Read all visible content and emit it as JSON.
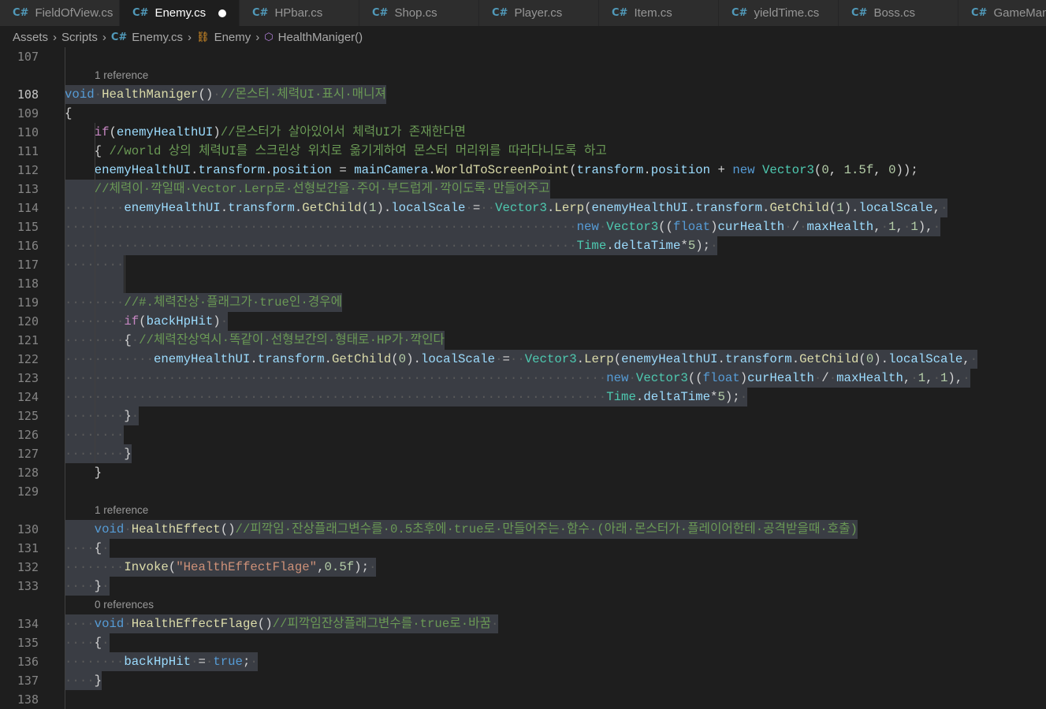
{
  "tabs": [
    {
      "label": "FieldOfView.cs",
      "icon": "csharp-file-icon",
      "active": false,
      "modified": false
    },
    {
      "label": "Enemy.cs",
      "icon": "csharp-file-icon",
      "active": true,
      "modified": true
    },
    {
      "label": "HPbar.cs",
      "icon": "csharp-file-icon",
      "active": false,
      "modified": false
    },
    {
      "label": "Shop.cs",
      "icon": "csharp-file-icon",
      "active": false,
      "modified": false
    },
    {
      "label": "Player.cs",
      "icon": "csharp-file-icon",
      "active": false,
      "modified": false
    },
    {
      "label": "Item.cs",
      "icon": "csharp-file-icon",
      "active": false,
      "modified": false
    },
    {
      "label": "yieldTime.cs",
      "icon": "csharp-file-icon",
      "active": false,
      "modified": false
    },
    {
      "label": "Boss.cs",
      "icon": "csharp-file-icon",
      "active": false,
      "modified": false
    },
    {
      "label": "GameManager.cs",
      "icon": "csharp-file-icon",
      "active": false,
      "modified": false
    }
  ],
  "breadcrumb": [
    {
      "label": "Assets",
      "icon": ""
    },
    {
      "label": "Scripts",
      "icon": ""
    },
    {
      "label": "Enemy.cs",
      "icon": "csharp-file-icon"
    },
    {
      "label": "Enemy",
      "icon": "class-icon"
    },
    {
      "label": "HealthManiger()",
      "icon": "method-icon"
    }
  ],
  "colors": {
    "editor_bg": "#1e1e1e",
    "tab_bar_bg": "#252526",
    "selection_bg": "#3a3d44",
    "keyword": "#569cd6",
    "control": "#c586c0",
    "function": "#dcdcaa",
    "variable": "#9cdcfe",
    "type": "#4ec9b0",
    "number": "#b5cea8",
    "string": "#ce9178",
    "comment": "#6a9955"
  },
  "lines": [
    {
      "ln": "107",
      "tokens": []
    },
    {
      "lens": "1 reference"
    },
    {
      "ln": "108",
      "current": true,
      "sel": true,
      "tokens": [
        [
          "kw",
          "void"
        ],
        [
          "ws",
          "·"
        ],
        [
          "fn",
          "HealthManiger"
        ],
        [
          "p",
          "()"
        ],
        [
          "ws",
          "·"
        ],
        [
          "cm",
          "//몬스터·체력UI·표시·매니져"
        ]
      ]
    },
    {
      "ln": "109",
      "tokens": [
        [
          "p",
          "{"
        ]
      ]
    },
    {
      "ln": "110",
      "indent": 1,
      "tokens": [
        [
          "ctl",
          "if"
        ],
        [
          "p",
          "("
        ],
        [
          "var",
          "enemyHealthUI"
        ],
        [
          "p",
          ")"
        ],
        [
          "cm",
          "//몬스터가 살아있어서 체력UI가 존재한다면"
        ]
      ]
    },
    {
      "ln": "111",
      "indent": 1,
      "tokens": [
        [
          "p",
          "{ "
        ],
        [
          "cm",
          "//world 상의 체력UI를 스크린상 위치로 옮기게하여 몬스터 머리위를 따라다니도록 하고"
        ]
      ]
    },
    {
      "ln": "112",
      "indent": 1,
      "tokens": [
        [
          "var",
          "enemyHealthUI"
        ],
        [
          "p",
          "."
        ],
        [
          "var",
          "transform"
        ],
        [
          "p",
          "."
        ],
        [
          "var",
          "position"
        ],
        [
          "p",
          " = "
        ],
        [
          "var",
          "mainCamera"
        ],
        [
          "p",
          "."
        ],
        [
          "fn",
          "WorldToScreenPoint"
        ],
        [
          "p",
          "("
        ],
        [
          "var",
          "transform"
        ],
        [
          "p",
          "."
        ],
        [
          "var",
          "position"
        ],
        [
          "p",
          " + "
        ],
        [
          "kw",
          "new"
        ],
        [
          "p",
          " "
        ],
        [
          "type",
          "Vector3"
        ],
        [
          "p",
          "("
        ],
        [
          "num",
          "0"
        ],
        [
          "p",
          ", "
        ],
        [
          "num",
          "1.5f"
        ],
        [
          "p",
          ", "
        ],
        [
          "num",
          "0"
        ],
        [
          "p",
          "));"
        ]
      ]
    },
    {
      "ln": "113",
      "indent": 1,
      "sel": true,
      "tokens": [
        [
          "cm",
          "//체력이·깍일때·Vector.Lerp로·선형보간을·주어·부드럽게·깍이도록·만들어주고"
        ]
      ]
    },
    {
      "ln": "114",
      "sel": true,
      "tokens": [
        [
          "ws",
          "········"
        ],
        [
          "var",
          "enemyHealthUI"
        ],
        [
          "p",
          "."
        ],
        [
          "var",
          "transform"
        ],
        [
          "p",
          "."
        ],
        [
          "fn",
          "GetChild"
        ],
        [
          "p",
          "("
        ],
        [
          "num",
          "1"
        ],
        [
          "p",
          ")."
        ],
        [
          "var",
          "localScale"
        ],
        [
          "ws",
          "·"
        ],
        [
          "p",
          "="
        ],
        [
          "ws",
          "··"
        ],
        [
          "type",
          "Vector3"
        ],
        [
          "p",
          "."
        ],
        [
          "fn",
          "Lerp"
        ],
        [
          "p",
          "("
        ],
        [
          "var",
          "enemyHealthUI"
        ],
        [
          "p",
          "."
        ],
        [
          "var",
          "transform"
        ],
        [
          "p",
          "."
        ],
        [
          "fn",
          "GetChild"
        ],
        [
          "p",
          "("
        ],
        [
          "num",
          "1"
        ],
        [
          "p",
          ")."
        ],
        [
          "var",
          "localScale"
        ],
        [
          "p",
          ","
        ],
        [
          "ws",
          "·"
        ]
      ]
    },
    {
      "ln": "115",
      "sel": true,
      "tokens": [
        [
          "ws",
          "·····································································"
        ],
        [
          "kw",
          "new"
        ],
        [
          "ws",
          "·"
        ],
        [
          "type",
          "Vector3"
        ],
        [
          "p",
          "(("
        ],
        [
          "kw",
          "float"
        ],
        [
          "p",
          ")"
        ],
        [
          "var",
          "curHealth"
        ],
        [
          "ws",
          "·"
        ],
        [
          "p",
          "/"
        ],
        [
          "ws",
          "·"
        ],
        [
          "var",
          "maxHealth"
        ],
        [
          "p",
          ","
        ],
        [
          "ws",
          "·"
        ],
        [
          "num",
          "1"
        ],
        [
          "p",
          ","
        ],
        [
          "ws",
          "·"
        ],
        [
          "num",
          "1"
        ],
        [
          "p",
          "),"
        ],
        [
          "ws",
          "·"
        ]
      ]
    },
    {
      "ln": "116",
      "sel": true,
      "tokens": [
        [
          "ws",
          "·····································································"
        ],
        [
          "type",
          "Time"
        ],
        [
          "p",
          "."
        ],
        [
          "var",
          "deltaTime"
        ],
        [
          "p",
          "*"
        ],
        [
          "num",
          "5"
        ],
        [
          "p",
          ");"
        ],
        [
          "ws",
          "·"
        ]
      ]
    },
    {
      "ln": "117",
      "sel": true,
      "tokens": [
        [
          "ws",
          "········"
        ]
      ]
    },
    {
      "ln": "118",
      "sel": true,
      "tokens": [
        [
          "p",
          "        "
        ]
      ]
    },
    {
      "ln": "119",
      "sel": true,
      "tokens": [
        [
          "ws",
          "········"
        ],
        [
          "cm",
          "//#.체력잔상·플래그가·true인·경우에"
        ]
      ]
    },
    {
      "ln": "120",
      "sel": true,
      "tokens": [
        [
          "ws",
          "········"
        ],
        [
          "ctl",
          "if"
        ],
        [
          "p",
          "("
        ],
        [
          "var",
          "backHpHit"
        ],
        [
          "p",
          ")"
        ],
        [
          "ws",
          "·"
        ]
      ]
    },
    {
      "ln": "121",
      "sel": true,
      "tokens": [
        [
          "ws",
          "········"
        ],
        [
          "p",
          "{"
        ],
        [
          "ws",
          "·"
        ],
        [
          "cm",
          "//체력잔상역시·똑같이·선형보간의·형태로·HP가·깍인다"
        ]
      ]
    },
    {
      "ln": "122",
      "sel": true,
      "tokens": [
        [
          "ws",
          "············"
        ],
        [
          "var",
          "enemyHealthUI"
        ],
        [
          "p",
          "."
        ],
        [
          "var",
          "transform"
        ],
        [
          "p",
          "."
        ],
        [
          "fn",
          "GetChild"
        ],
        [
          "p",
          "("
        ],
        [
          "num",
          "0"
        ],
        [
          "p",
          ")."
        ],
        [
          "var",
          "localScale"
        ],
        [
          "ws",
          "·"
        ],
        [
          "p",
          "="
        ],
        [
          "ws",
          "··"
        ],
        [
          "type",
          "Vector3"
        ],
        [
          "p",
          "."
        ],
        [
          "fn",
          "Lerp"
        ],
        [
          "p",
          "("
        ],
        [
          "var",
          "enemyHealthUI"
        ],
        [
          "p",
          "."
        ],
        [
          "var",
          "transform"
        ],
        [
          "p",
          "."
        ],
        [
          "fn",
          "GetChild"
        ],
        [
          "p",
          "("
        ],
        [
          "num",
          "0"
        ],
        [
          "p",
          ")."
        ],
        [
          "var",
          "localScale"
        ],
        [
          "p",
          ","
        ],
        [
          "ws",
          "·"
        ]
      ]
    },
    {
      "ln": "123",
      "sel": true,
      "tokens": [
        [
          "ws",
          "·········································································"
        ],
        [
          "kw",
          "new"
        ],
        [
          "ws",
          "·"
        ],
        [
          "type",
          "Vector3"
        ],
        [
          "p",
          "(("
        ],
        [
          "kw",
          "float"
        ],
        [
          "p",
          ")"
        ],
        [
          "var",
          "curHealth"
        ],
        [
          "ws",
          "·"
        ],
        [
          "p",
          "/"
        ],
        [
          "ws",
          "·"
        ],
        [
          "var",
          "maxHealth"
        ],
        [
          "p",
          ","
        ],
        [
          "ws",
          "·"
        ],
        [
          "num",
          "1"
        ],
        [
          "p",
          ","
        ],
        [
          "ws",
          "·"
        ],
        [
          "num",
          "1"
        ],
        [
          "p",
          "),"
        ],
        [
          "ws",
          "·"
        ]
      ]
    },
    {
      "ln": "124",
      "sel": true,
      "tokens": [
        [
          "ws",
          "·········································································"
        ],
        [
          "type",
          "Time"
        ],
        [
          "p",
          "."
        ],
        [
          "var",
          "deltaTime"
        ],
        [
          "p",
          "*"
        ],
        [
          "num",
          "5"
        ],
        [
          "p",
          ");"
        ],
        [
          "ws",
          "·"
        ]
      ]
    },
    {
      "ln": "125",
      "sel": true,
      "tokens": [
        [
          "ws",
          "········"
        ],
        [
          "p",
          "}"
        ],
        [
          "ws",
          "·"
        ]
      ]
    },
    {
      "ln": "126",
      "sel": true,
      "tokens": [
        [
          "ws",
          "········"
        ]
      ]
    },
    {
      "ln": "127",
      "sel": true,
      "tokens": [
        [
          "ws",
          "········"
        ],
        [
          "p",
          "}"
        ]
      ]
    },
    {
      "ln": "128",
      "indent": 1,
      "tokens": [
        [
          "p",
          "}"
        ]
      ]
    },
    {
      "ln": "129",
      "tokens": []
    },
    {
      "lens": "1 reference"
    },
    {
      "ln": "130",
      "sel": true,
      "tokens": [
        [
          "p",
          "    "
        ],
        [
          "kw",
          "void"
        ],
        [
          "ws",
          "·"
        ],
        [
          "fn",
          "HealthEffect"
        ],
        [
          "p",
          "()"
        ],
        [
          "cm",
          "//피깍임·잔상플래그변수를·0.5초후에·true로·만들어주는·함수·(아래·몬스터가·플레이어한테·공격받을때·호출)"
        ]
      ]
    },
    {
      "ln": "131",
      "sel": true,
      "tokens": [
        [
          "ws",
          "····"
        ],
        [
          "p",
          "{"
        ],
        [
          "ws",
          "·"
        ]
      ]
    },
    {
      "ln": "132",
      "sel": true,
      "tokens": [
        [
          "ws",
          "········"
        ],
        [
          "fn",
          "Invoke"
        ],
        [
          "p",
          "("
        ],
        [
          "str",
          "\"HealthEffectFlage\""
        ],
        [
          "p",
          ","
        ],
        [
          "num",
          "0.5f"
        ],
        [
          "p",
          ");"
        ],
        [
          "ws",
          "·"
        ]
      ]
    },
    {
      "ln": "133",
      "sel": true,
      "tokens": [
        [
          "ws",
          "····"
        ],
        [
          "p",
          "}"
        ],
        [
          "ws",
          "·"
        ]
      ]
    },
    {
      "lens": "0 references"
    },
    {
      "ln": "134",
      "sel": true,
      "tokens": [
        [
          "ws",
          "····"
        ],
        [
          "kw",
          "void"
        ],
        [
          "ws",
          "·"
        ],
        [
          "fn",
          "HealthEffectFlage"
        ],
        [
          "p",
          "()"
        ],
        [
          "cm",
          "//피깍임잔상플래그변수를·true로·바꿈"
        ],
        [
          "ws",
          "·"
        ]
      ]
    },
    {
      "ln": "135",
      "sel": true,
      "tokens": [
        [
          "ws",
          "····"
        ],
        [
          "p",
          "{"
        ],
        [
          "ws",
          "·"
        ]
      ]
    },
    {
      "ln": "136",
      "sel": true,
      "tokens": [
        [
          "ws",
          "········"
        ],
        [
          "var",
          "backHpHit"
        ],
        [
          "ws",
          "·"
        ],
        [
          "p",
          "="
        ],
        [
          "ws",
          "·"
        ],
        [
          "kw",
          "true"
        ],
        [
          "p",
          ";"
        ],
        [
          "ws",
          "·"
        ]
      ]
    },
    {
      "ln": "137",
      "sel": true,
      "tokens": [
        [
          "ws",
          "····"
        ],
        [
          "p",
          "}"
        ]
      ]
    },
    {
      "ln": "138",
      "tokens": []
    }
  ]
}
